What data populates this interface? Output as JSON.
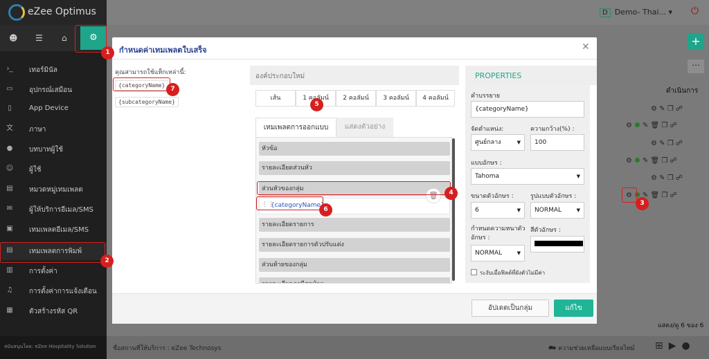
{
  "app": {
    "logo_text": "eZee Optimus",
    "property": "Demo- Thai...",
    "property_badge": "D"
  },
  "sidebar": {
    "items": [
      {
        "label": "เทอร์มินัล",
        "icon": "terminal-icon"
      },
      {
        "label": "อุปกรณ์เสมือน",
        "icon": "tablet-icon"
      },
      {
        "label": "App Device",
        "icon": "mobile-icon"
      },
      {
        "label": "ภาษา",
        "icon": "language-icon"
      },
      {
        "label": "บทบาทผู้ใช้",
        "icon": "user-role-icon"
      },
      {
        "label": "ผู้ใช้",
        "icon": "user-icon"
      },
      {
        "label": "หมวดหมู่เทมเพลต",
        "icon": "inbox-icon"
      },
      {
        "label": "ผู้ให้บริการอีเมล/SMS",
        "icon": "mail-icon"
      },
      {
        "label": "เทมเพลตอีเมล/SMS",
        "icon": "window-icon"
      },
      {
        "label": "เทมเพลตการพิมพ์",
        "icon": "print-template-icon"
      },
      {
        "label": "การตั้งค่า",
        "icon": "settings-list-icon"
      },
      {
        "label": "การตั้งค่าการแจ้งเตือน",
        "icon": "bell-icon"
      },
      {
        "label": "ตัวสร้างรหัส QR",
        "icon": "qr-icon"
      }
    ],
    "footer": "สนับสนุนโดย: eZee Hospitality Solution"
  },
  "page": {
    "action_header": "ดำเนินการ",
    "pagination": "แสดง/ดู 6 ของ 6",
    "provider": "ชื่อสถานที่ให้บริการ : eZee Technosys",
    "helpline": "ความช่วยเหลือแบบเรียลไทม์"
  },
  "modal": {
    "title": "กำหนดค่าเทมเพลตใบเสร็จ",
    "left_title": "คุณสามารถใช้แท็กเหล่านี้:",
    "tags": [
      "{categoryName}",
      "{subcategoryName}"
    ],
    "center_title": "องค์ประกอบใหม่",
    "columns": [
      "เส้น",
      "1 คอลัมน์",
      "2 คอลัมน์",
      "3 คอลัมน์",
      "4 คอลัมน์"
    ],
    "tabs": [
      "เทมเพลตการออกแบบ",
      "แสดงตัวอย่าง"
    ],
    "blocks": [
      "หัวข้อ",
      "รายละเอียดส่วนหัว",
      "ส่วนหัวของกลุ่ม",
      "รายละเอียดรายการ",
      "รายละเอียดรายการตัวปรับแต่ง",
      "ส่วนท้ายของกลุ่ม",
      "รายละเอียดภาษีสุดท้าย"
    ],
    "block_field": "{categoryName}",
    "update_group_button": "อัปเดตเป็นกลุ่ม",
    "edit_button": "แก้ไข"
  },
  "properties": {
    "title": "PROPERTIES",
    "description_label": "คำบรรยาย",
    "description_value": "{categoryName}",
    "align_label": "จัดตำแหน่ง:",
    "align_value": "ศูนย์กลาง",
    "width_label": "ความกว้าง(%) :",
    "width_value": "100",
    "font_label": "แบบอักษร :",
    "font_value": "Tahoma",
    "font_size_label": "ขนาดตัวอักษร :",
    "font_size_value": "6",
    "font_style_label": "รูปแบบตัวอักษร :",
    "font_style_value": "NORMAL",
    "font_weight_label": "กำหนดความหนาตัวอักษร :",
    "font_weight_value": "NORMAL",
    "font_color_label": "สีตัวอักษร :",
    "font_color_value": "#000000",
    "hide_label": "ระงับเมื่อฟิลด์ที่ผังตัวไม่มีค่า"
  },
  "callouts": [
    "1",
    "2",
    "3",
    "4",
    "5",
    "6",
    "7"
  ],
  "colors": {
    "accent": "#1fa58a",
    "marker": "#d61f1f",
    "title": "#2b3f8f"
  }
}
